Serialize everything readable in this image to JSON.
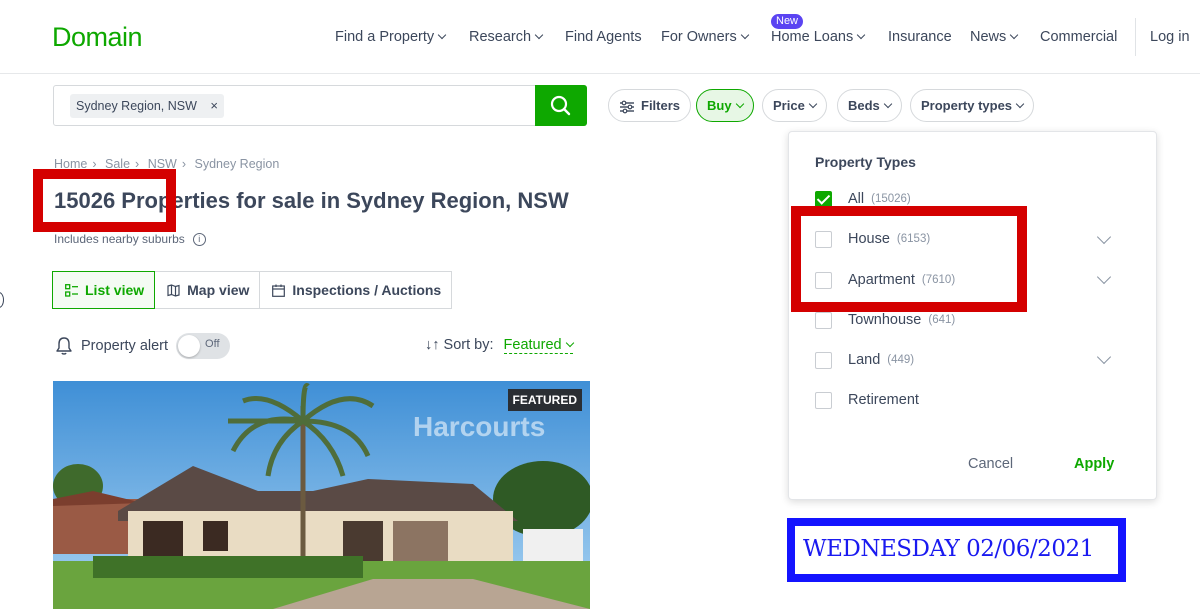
{
  "header": {
    "logo": "Domain",
    "nav": [
      {
        "label": "Find a Property",
        "caret": true
      },
      {
        "label": "Research",
        "caret": true
      },
      {
        "label": "Find Agents",
        "caret": false
      },
      {
        "label": "For Owners",
        "caret": true
      },
      {
        "label": "Home Loans",
        "caret": true,
        "badge": "New"
      },
      {
        "label": "Insurance",
        "caret": false
      },
      {
        "label": "News",
        "caret": true
      },
      {
        "label": "Commercial",
        "caret": false
      }
    ],
    "login": "Log in"
  },
  "search": {
    "chip": "Sydney Region, NSW",
    "chip_remove": "×"
  },
  "filters": {
    "filters_label": "Filters",
    "buy": "Buy",
    "price": "Price",
    "beds": "Beds",
    "property_types": "Property types"
  },
  "breadcrumb": [
    "Home",
    "Sale",
    "NSW",
    "Sydney Region"
  ],
  "results": {
    "title": "15026 Properties for sale in Sydney Region, NSW",
    "subtitle": "Includes nearby suburbs"
  },
  "views": {
    "list": "List view",
    "map": "Map view",
    "inspections": "Inspections / Auctions"
  },
  "alert": {
    "label": "Property alert",
    "toggle": "Off"
  },
  "sort": {
    "label": "Sort by:",
    "value": "Featured"
  },
  "listing": {
    "badge": "FEATURED",
    "watermark": "Harcourts"
  },
  "dropdown": {
    "title": "Property Types",
    "options": [
      {
        "label": "All",
        "count": "(15026)",
        "checked": true,
        "expandable": false
      },
      {
        "label": "House",
        "count": "(6153)",
        "checked": false,
        "expandable": true
      },
      {
        "label": "Apartment",
        "count": "(7610)",
        "checked": false,
        "expandable": true
      },
      {
        "label": "Townhouse",
        "count": "(641)",
        "checked": false,
        "expandable": false
      },
      {
        "label": "Land",
        "count": "(449)",
        "checked": false,
        "expandable": true
      },
      {
        "label": "Retirement",
        "count": "",
        "checked": false,
        "expandable": false
      }
    ],
    "cancel": "Cancel",
    "apply": "Apply"
  },
  "date_stamp": "WEDNESDAY 02/06/2021",
  "colors": {
    "brand_green": "#0ea800",
    "annotation_red": "#d40000",
    "annotation_blue": "#1414ff",
    "new_badge": "#5b44f2"
  }
}
